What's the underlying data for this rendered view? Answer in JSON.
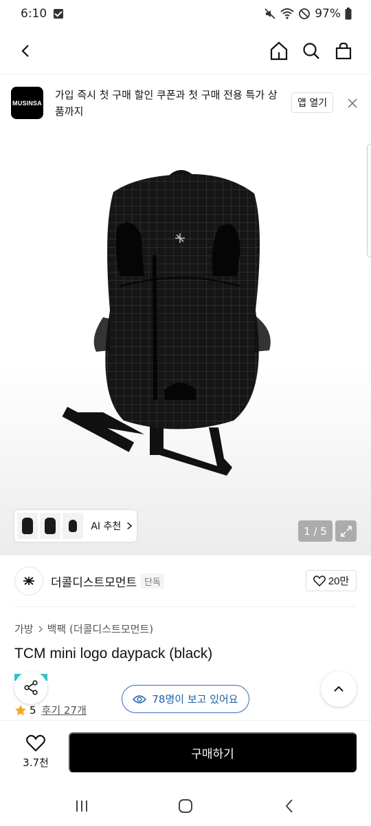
{
  "status": {
    "time": "6:10",
    "battery": "97%"
  },
  "header": {
    "back_icon": "back-arrow-icon",
    "home_icon": "home-icon",
    "search_icon": "search-icon",
    "cart_icon": "shopping-bag-icon"
  },
  "promo": {
    "logo_text": "MUSINSA",
    "message": "가입 즉시 첫 구매 할인 쿠폰과 첫 구매 전용 특가 상품까지",
    "open_label": "앱 열기"
  },
  "gallery": {
    "counter": "1 / 5",
    "ai_label": "AI 추천"
  },
  "brand": {
    "name": "더콜디스트모먼트",
    "tag": "단독",
    "likes": "20만"
  },
  "breadcrumb": {
    "category": "가방",
    "subcategory": "백팩 (더콜디스트모먼트)"
  },
  "product": {
    "title": "TCM mini logo daypack (black)"
  },
  "viewers": "78명이 보고 있어요",
  "rating": {
    "score": "5",
    "reviews": "후기 27개"
  },
  "buy_bar": {
    "wish_count": "3.7천",
    "buy_label": "구매하기"
  },
  "colors": {
    "accent": "#2b6fb6",
    "button": "#000000",
    "star": "#f5a623"
  }
}
